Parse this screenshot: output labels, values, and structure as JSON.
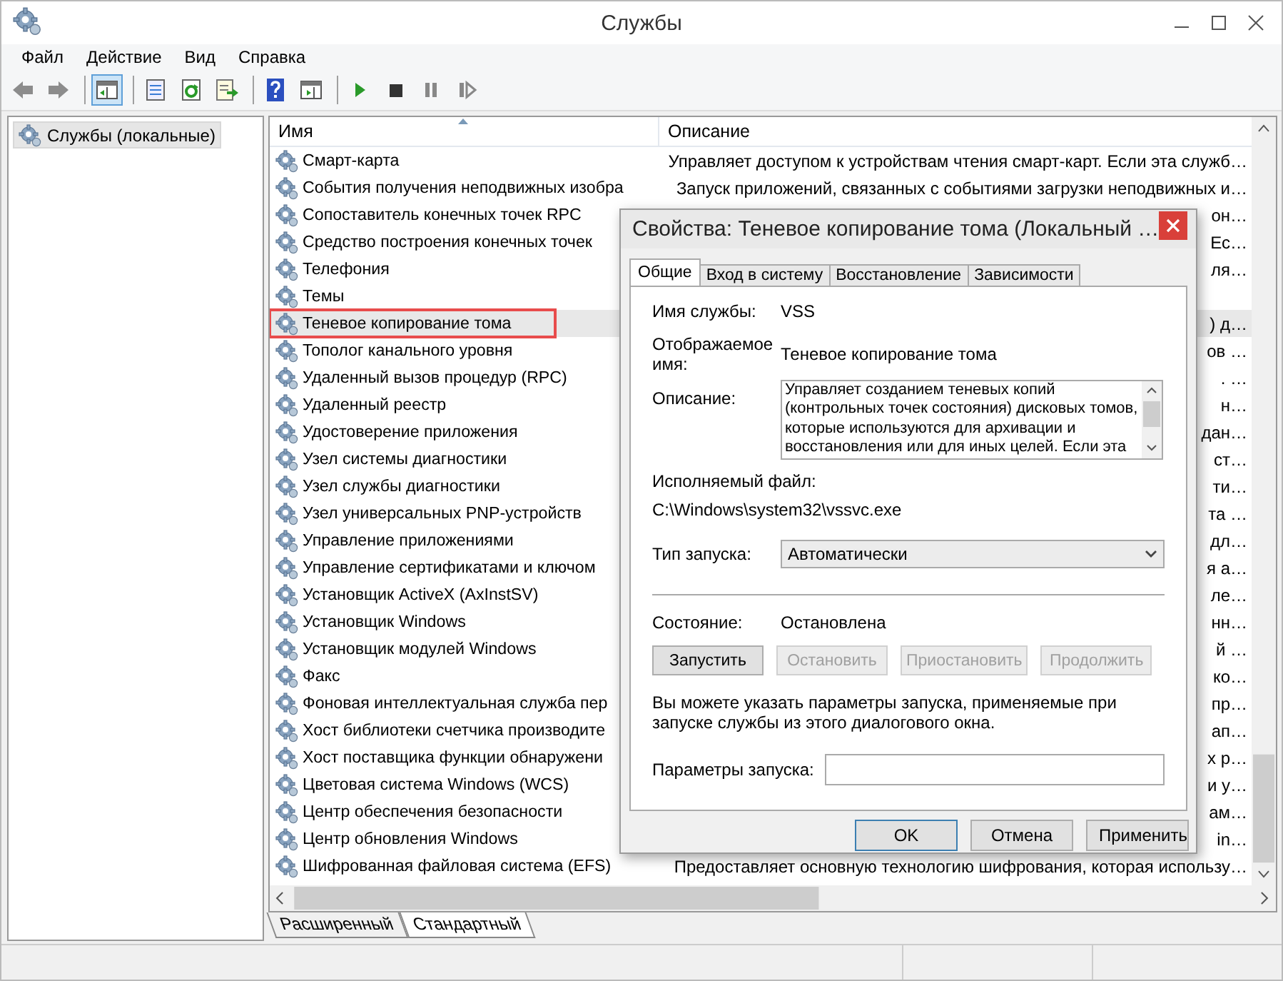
{
  "window": {
    "title": "Службы"
  },
  "menu": [
    "Файл",
    "Действие",
    "Вид",
    "Справка"
  ],
  "toolbar": [
    {
      "kind": "back",
      "pressed": false
    },
    {
      "kind": "forward",
      "pressed": false
    },
    {
      "kind": "separator"
    },
    {
      "kind": "tree",
      "pressed": true
    },
    {
      "kind": "separator"
    },
    {
      "kind": "properties",
      "pressed": false
    },
    {
      "kind": "refresh",
      "pressed": false
    },
    {
      "kind": "export",
      "pressed": false
    },
    {
      "kind": "separator"
    },
    {
      "kind": "help",
      "pressed": false
    },
    {
      "kind": "console",
      "pressed": false
    },
    {
      "kind": "separator"
    },
    {
      "kind": "play",
      "pressed": false
    },
    {
      "kind": "stop",
      "pressed": false
    },
    {
      "kind": "pause",
      "pressed": false
    },
    {
      "kind": "resume",
      "pressed": false
    }
  ],
  "tree": [
    {
      "label": "Службы (локальные)",
      "selected": true
    }
  ],
  "list": {
    "columns": [
      {
        "label": "Имя",
        "sorted": true
      },
      {
        "label": "Описание",
        "sorted": false
      }
    ],
    "rows": [
      {
        "name": "Смарт-карта",
        "description": "Управляет доступом к устройствам чтения смарт-карт. Если эта служб…",
        "selected": false,
        "marked": false
      },
      {
        "name": "События получения неподвижных изобра",
        "description": "Запуск приложений, связанных с событиями загрузки неподвижных и…",
        "selected": false,
        "marked": false
      },
      {
        "name": "Сопоставитель конечных точек RPC",
        "description": "он…",
        "selected": false,
        "marked": false
      },
      {
        "name": "Средство построения конечных точек",
        "description": "Ес…",
        "selected": false,
        "marked": false
      },
      {
        "name": "Телефония",
        "description": "ля…",
        "selected": false,
        "marked": false
      },
      {
        "name": "Темы",
        "selected": false,
        "marked": false
      },
      {
        "name": "Теневое копирование тома",
        "description": ") д…",
        "selected": true,
        "marked": true
      },
      {
        "name": "Тополог канального уровня",
        "description": "ов …",
        "selected": false,
        "marked": false
      },
      {
        "name": "Удаленный вызов процедур (RPC)",
        "description": ". …",
        "selected": false,
        "marked": false
      },
      {
        "name": "Удаленный реестр",
        "description": "н…",
        "selected": false,
        "marked": false
      },
      {
        "name": "Удостоверение приложения",
        "description": "дан…",
        "selected": false,
        "marked": false
      },
      {
        "name": "Узел системы диагностики",
        "description": "ст…",
        "selected": false,
        "marked": false
      },
      {
        "name": "Узел службы диагностики",
        "description": "ти…",
        "selected": false,
        "marked": false
      },
      {
        "name": "Узел универсальных PNP-устройств",
        "description": "та …",
        "selected": false,
        "marked": false
      },
      {
        "name": "Управление приложениями",
        "description": "дл…",
        "selected": false,
        "marked": false
      },
      {
        "name": "Управление сертификатами и ключом",
        "description": "я а…",
        "selected": false,
        "marked": false
      },
      {
        "name": "Установщик ActiveX (AxInstSV)",
        "description": "ле…",
        "selected": false,
        "marked": false
      },
      {
        "name": "Установщик Windows",
        "description": "нн…",
        "selected": false,
        "marked": false
      },
      {
        "name": "Установщик модулей Windows",
        "description": "й …",
        "selected": false,
        "marked": false
      },
      {
        "name": "Факс",
        "description": "ко…",
        "selected": false,
        "marked": false
      },
      {
        "name": "Фоновая интеллектуальная служба пер",
        "description": "пр…",
        "selected": false,
        "marked": false
      },
      {
        "name": "Хост библиотеки счетчика производите",
        "description": "ап…",
        "selected": false,
        "marked": false
      },
      {
        "name": "Хост поставщика функции обнаружени",
        "description": "х р…",
        "selected": false,
        "marked": false
      },
      {
        "name": "Цветовая система Windows (WCS)",
        "description": "и у…",
        "selected": false,
        "marked": false
      },
      {
        "name": "Центр обеспечения безопасности",
        "description": "ам…",
        "selected": false,
        "marked": false
      },
      {
        "name": "Центр обновления Windows",
        "description": "in…",
        "selected": false,
        "marked": false
      },
      {
        "name": "Шифрованная файловая система (EFS)",
        "description": "Предоставляет основную технологию шифрования, которая использу…",
        "selected": false,
        "marked": false
      }
    ]
  },
  "view_tabs": [
    {
      "label": "Расширенный",
      "selected": false
    },
    {
      "label": "Стандартный",
      "selected": true
    }
  ],
  "dialog": {
    "title": "Свойства: Теневое копирование тома (Локальный …",
    "tabs": [
      {
        "label": "Общие",
        "selected": true
      },
      {
        "label": "Вход в систему",
        "selected": false
      },
      {
        "label": "Восстановление",
        "selected": false
      },
      {
        "label": "Зависимости",
        "selected": false
      }
    ],
    "service_name": {
      "label": "Имя службы:",
      "value": "VSS"
    },
    "display_name": {
      "label": "Отображаемое имя:",
      "value": "Теневое копирование тома"
    },
    "description": {
      "label": "Описание:",
      "value": "Управляет созданием теневых копий (контрольных точек состояния) дисковых томов, которые используются для архивации и восстановления или для иных целей. Если эта"
    },
    "executable": {
      "label": "Исполняемый файл:",
      "value": "C:\\Windows\\system32\\vssvc.exe"
    },
    "startup_type": {
      "label": "Тип запуска:",
      "value": "Автоматически"
    },
    "status": {
      "label": "Состояние:",
      "value": "Остановлена"
    },
    "control_buttons": [
      {
        "label": "Запустить",
        "disabled": false
      },
      {
        "label": "Остановить",
        "disabled": true
      },
      {
        "label": "Приостановить",
        "disabled": true
      },
      {
        "label": "Продолжить",
        "disabled": true
      }
    ],
    "hint": "Вы можете указать параметры запуска, применяемые при запуске службы из этого диалогового окна.",
    "start_params": {
      "label": "Параметры запуска:"
    },
    "buttons": [
      {
        "label": "OK",
        "default": true
      },
      {
        "label": "Отмена",
        "default": false
      },
      {
        "label": "Применить",
        "default": false
      }
    ]
  }
}
